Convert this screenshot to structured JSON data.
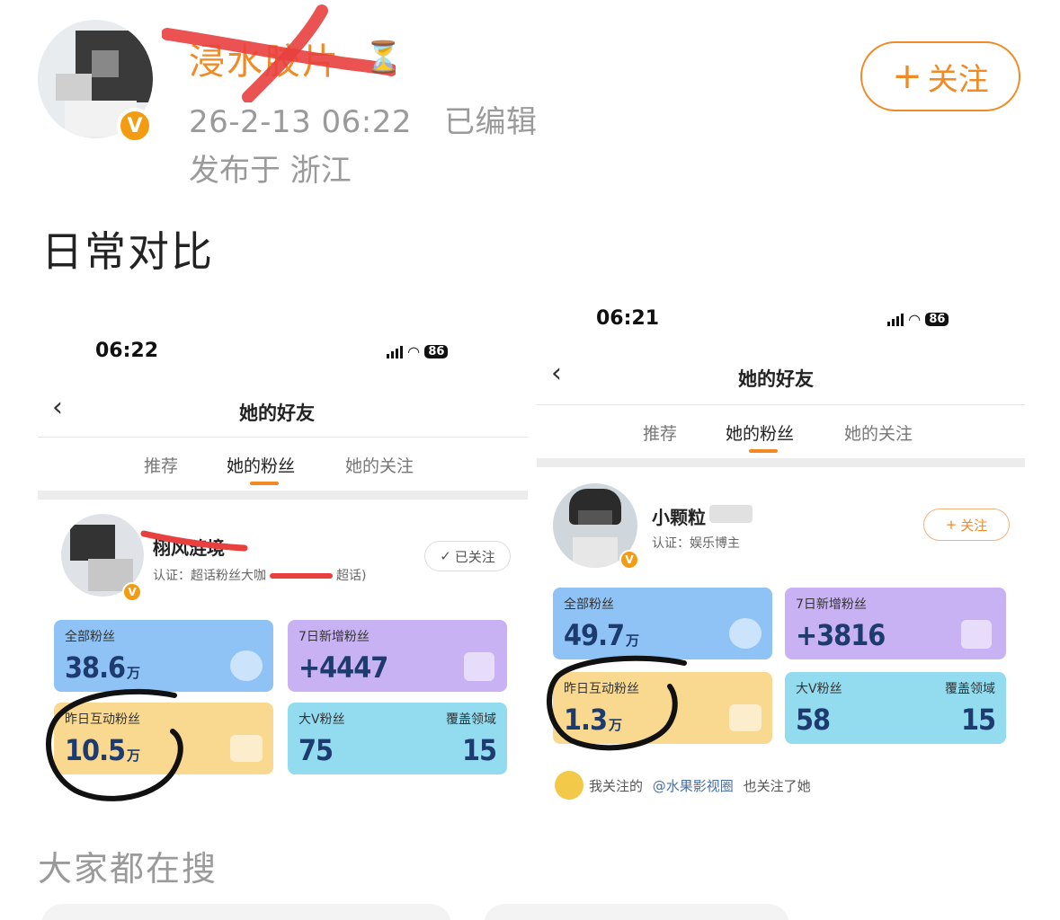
{
  "post": {
    "author_name": "浸水胶片",
    "author_status_icon": "hourglass-icon",
    "verified_badge": "V",
    "timestamp": "26-2-13 06:22",
    "edited_label": "已编辑",
    "location": "发布于 浙江",
    "follow_label": "关注",
    "follow_plus": "+",
    "text": "日常对比"
  },
  "left_screenshot": {
    "status_time": "06:22",
    "battery": "86",
    "nav_title": "她的好友",
    "tabs": [
      "推荐",
      "她的粉丝",
      "她的关注"
    ],
    "active_tab": 1,
    "user": {
      "name": "栩风涟境",
      "cert": "认证：超话粉丝大咖",
      "cert_suffix": "超话)",
      "follow_state": "已关注",
      "follow_check": "✓"
    },
    "stats": {
      "all_fans": {
        "label": "全部粉丝",
        "value": "38.6",
        "unit": "万"
      },
      "new_fans_7d": {
        "label": "7日新增粉丝",
        "value": "+4447"
      },
      "interactive_fans_yesterday": {
        "label": "昨日互动粉丝",
        "value": "10.5",
        "unit": "万"
      },
      "bigv_fans": {
        "label": "大V粉丝",
        "value": "75"
      },
      "coverage": {
        "label": "覆盖领域",
        "value": "15"
      }
    }
  },
  "right_screenshot": {
    "status_time": "06:21",
    "battery": "86",
    "nav_title": "她的好友",
    "tabs": [
      "推荐",
      "她的粉丝",
      "她的关注"
    ],
    "active_tab": 1,
    "user": {
      "name": "小颗粒",
      "cert": "认证：娱乐博主",
      "follow_label": "关注",
      "follow_plus": "+"
    },
    "stats": {
      "all_fans": {
        "label": "全部粉丝",
        "value": "49.7",
        "unit": "万"
      },
      "new_fans_7d": {
        "label": "7日新增粉丝",
        "value": "+3816"
      },
      "interactive_fans_yesterday": {
        "label": "昨日互动粉丝",
        "value": "1.3",
        "unit": "万"
      },
      "bigv_fans": {
        "label": "大V粉丝",
        "value": "58"
      },
      "coverage": {
        "label": "覆盖领域",
        "value": "15"
      }
    },
    "mutual_note": {
      "prefix": "我关注的",
      "mention": "@水果影视圈",
      "suffix": "也关注了她"
    }
  },
  "bottom": {
    "search_title": "大家都在搜"
  },
  "colors": {
    "accent": "#f08a24",
    "card_blue": "#8fc3f5",
    "card_purple": "#c9b2f3",
    "card_yellow": "#f9d98f",
    "card_cyan": "#93dcf0",
    "annotation_ink": "#111111",
    "redaction_red": "#e8403e"
  }
}
